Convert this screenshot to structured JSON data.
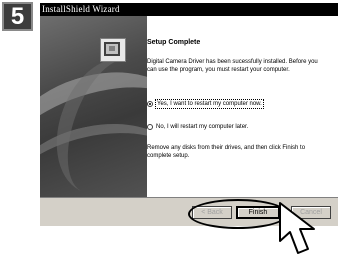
{
  "step": {
    "number": "5"
  },
  "window": {
    "title": "InstallShield Wizard",
    "heading": "Setup Complete",
    "description": "Digital Camera Driver has been sucessfully installed. Before you can use the program, you must restart your computer.",
    "options": [
      {
        "label": "Yes, I want to restart my computer now.",
        "checked": true
      },
      {
        "label": "No, I will restart my computer later.",
        "checked": false
      }
    ],
    "footer_text": "Remove any disks from their drives, and then click Finish to complete setup."
  },
  "buttons": {
    "back": "< Back",
    "finish": "Finish",
    "cancel": "Cancel"
  },
  "icons": {
    "installer": "computer-icon",
    "pointer": "hand-cursor-icon"
  },
  "colors": {
    "titlebar": "#000000",
    "dialog_bg": "#d4d0c8",
    "content_bg": "#ffffff"
  }
}
